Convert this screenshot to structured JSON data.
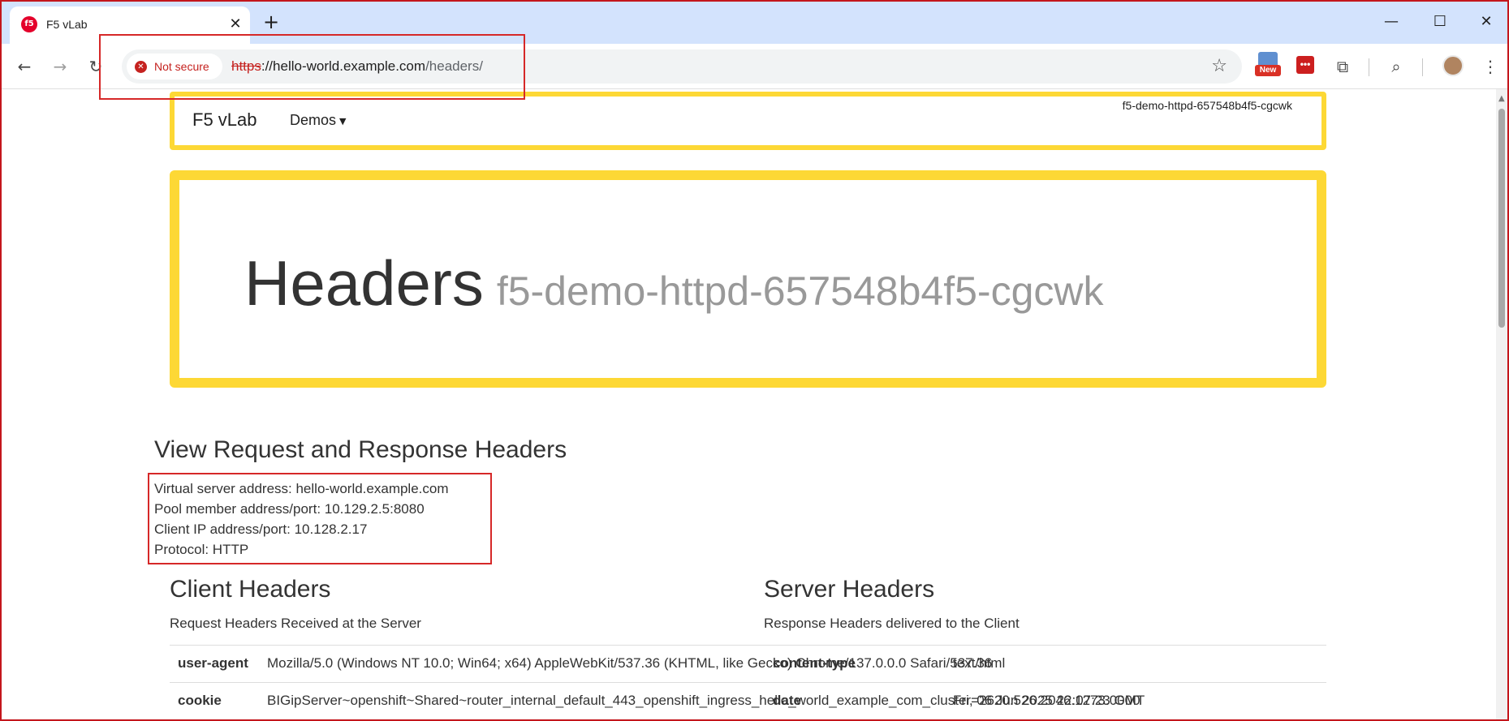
{
  "browser": {
    "tab": {
      "title": "F5 vLab",
      "favicon": "f5-logo-icon"
    },
    "new_tab_symbol": "+",
    "window_controls": {
      "minimize": "—",
      "maximize": "☐",
      "close": "✕"
    },
    "security_chip": "Not secure",
    "url": {
      "scheme": "https",
      "host_path": "://hello-world.example.com",
      "path": "/headers/"
    },
    "extension_badge": "New",
    "extension_red_glyph": "•••"
  },
  "navbar": {
    "brand": "F5 vLab",
    "demos_label": "Demos",
    "pod_name": "f5-demo-httpd-657548b4f5-cgcwk"
  },
  "jumbotron": {
    "title": "Headers",
    "subtitle": "f5-demo-httpd-657548b4f5-cgcwk"
  },
  "info": {
    "heading": "View Request and Response Headers",
    "lines": [
      "Virtual server address: hello-world.example.com",
      "Pool member address/port: 10.129.2.5:8080",
      "Client IP address/port: 10.128.2.17",
      "Protocol: HTTP"
    ]
  },
  "client_headers": {
    "title": "Client Headers",
    "subtitle": "Request Headers Received at the Server",
    "rows": [
      {
        "key": "user-agent",
        "value": "Mozilla/5.0 (Windows NT 10.0; Win64; x64) AppleWebKit/537.36 (KHTML, like Gecko) Chrome/137.0.0.0 Safari/537.36"
      },
      {
        "key": "cookie",
        "value": "BIGipServer~openshift~Shared~router_internal_default_443_openshift_ingress_hello_world_example_com_cluster=2620.526.2046.1273.0000"
      }
    ]
  },
  "server_headers": {
    "title": "Server Headers",
    "subtitle": "Response Headers delivered to the Client",
    "rows": [
      {
        "key": "content-type",
        "value": "text/html"
      },
      {
        "key": "date",
        "value": "Fri, 06 Jun 2025 22:07:23 GMT"
      }
    ]
  },
  "colors": {
    "highlight_yellow": "#fdd835",
    "annotation_red": "#d62828",
    "tab_strip": "#d3e3fd"
  }
}
